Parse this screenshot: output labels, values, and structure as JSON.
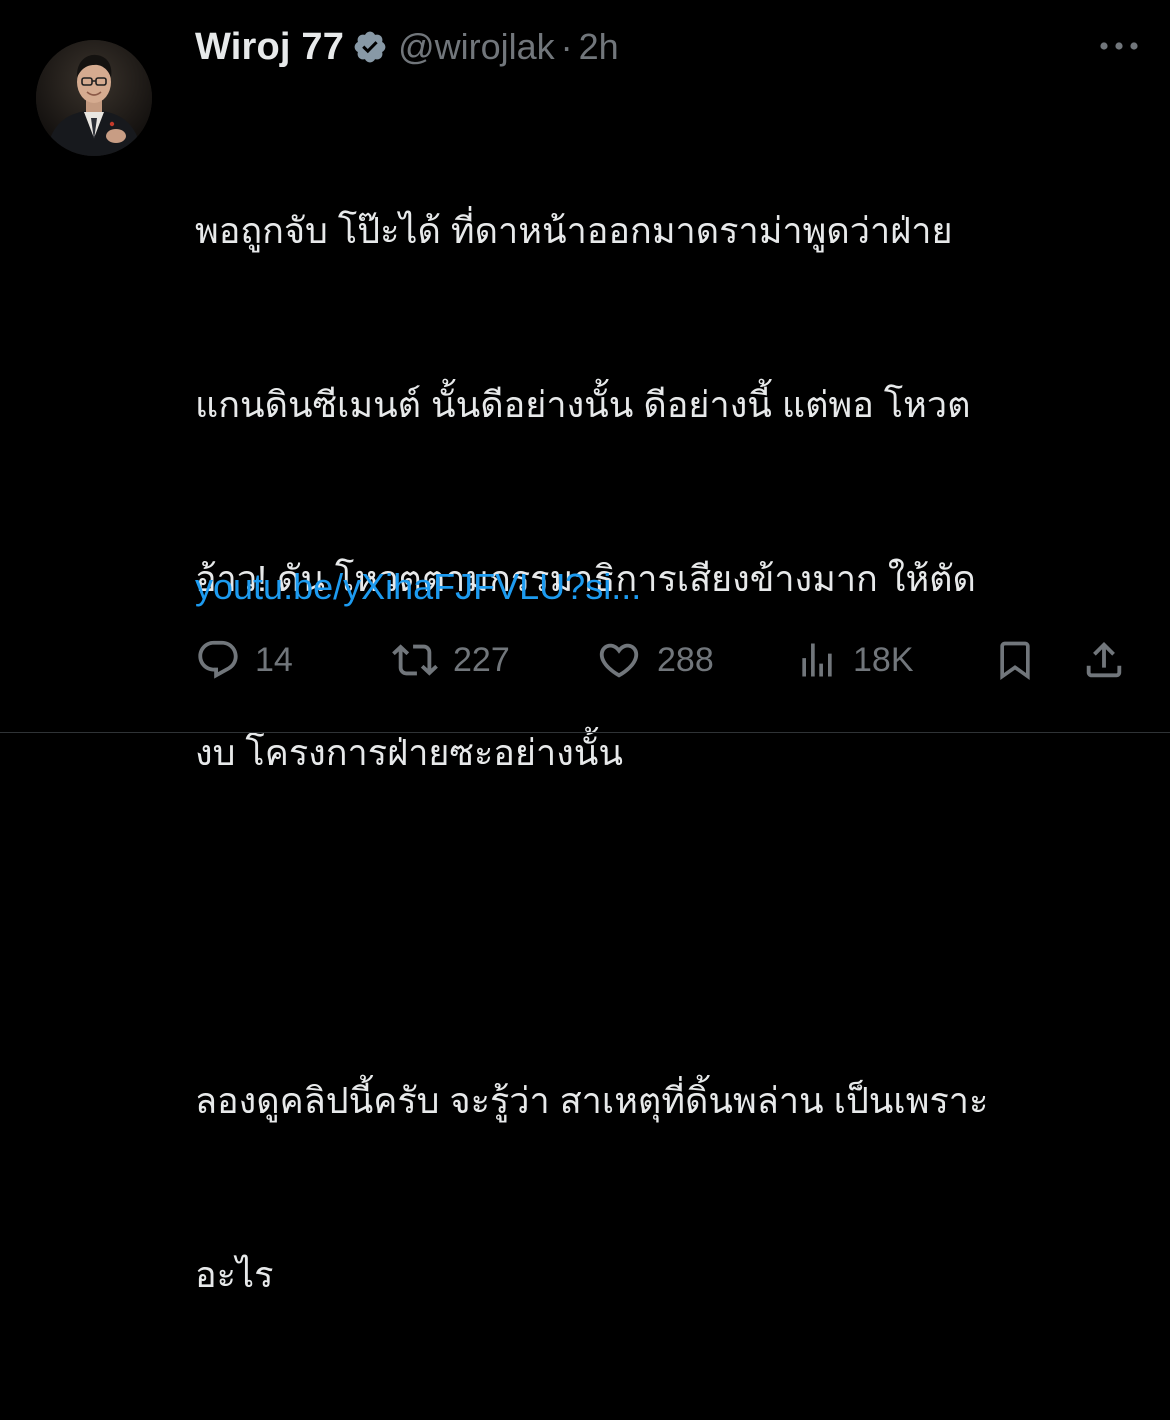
{
  "author": {
    "display_name": "Wiroj 77",
    "handle": "@wirojlak",
    "separator": "·",
    "time": "2h",
    "verified_badge_color": "#8899a6"
  },
  "post": {
    "lines": [
      "พอถูกจับ โป๊ะได้ ที่ดาหน้าออกมาดราม่าพูดว่าฝ่าย",
      "แกนดินซีเมนต์ นั้นดีอย่างนั้น ดีอย่างนี้ แต่พอ โหวต",
      "อ้าว! ดัน โหวตตามกรรมาธิการเสียงข้างมาก ให้ตัด",
      "งบ โครงการฝ่ายซะอย่างนั้น",
      "",
      "ลองดูคลิปนี้ครับ จะรู้ว่า สาเหตุที่ดิ้นพล่าน เป็นเพราะ",
      "อะไร"
    ],
    "link_text": "youtu.be/yXihaFJFVLU?si..."
  },
  "actions": {
    "replies": "14",
    "reposts": "227",
    "likes": "288",
    "views": "18K"
  },
  "icons": {
    "reply": "reply-icon",
    "repost": "repost-icon",
    "like": "heart-icon",
    "views": "views-icon",
    "bookmark": "bookmark-icon",
    "share": "share-icon",
    "more": "more-icon",
    "verified": "verified-badge-icon"
  },
  "colors": {
    "background": "#000000",
    "text": "#e7e9ea",
    "secondary": "#71767b",
    "link": "#1d9bf0"
  }
}
